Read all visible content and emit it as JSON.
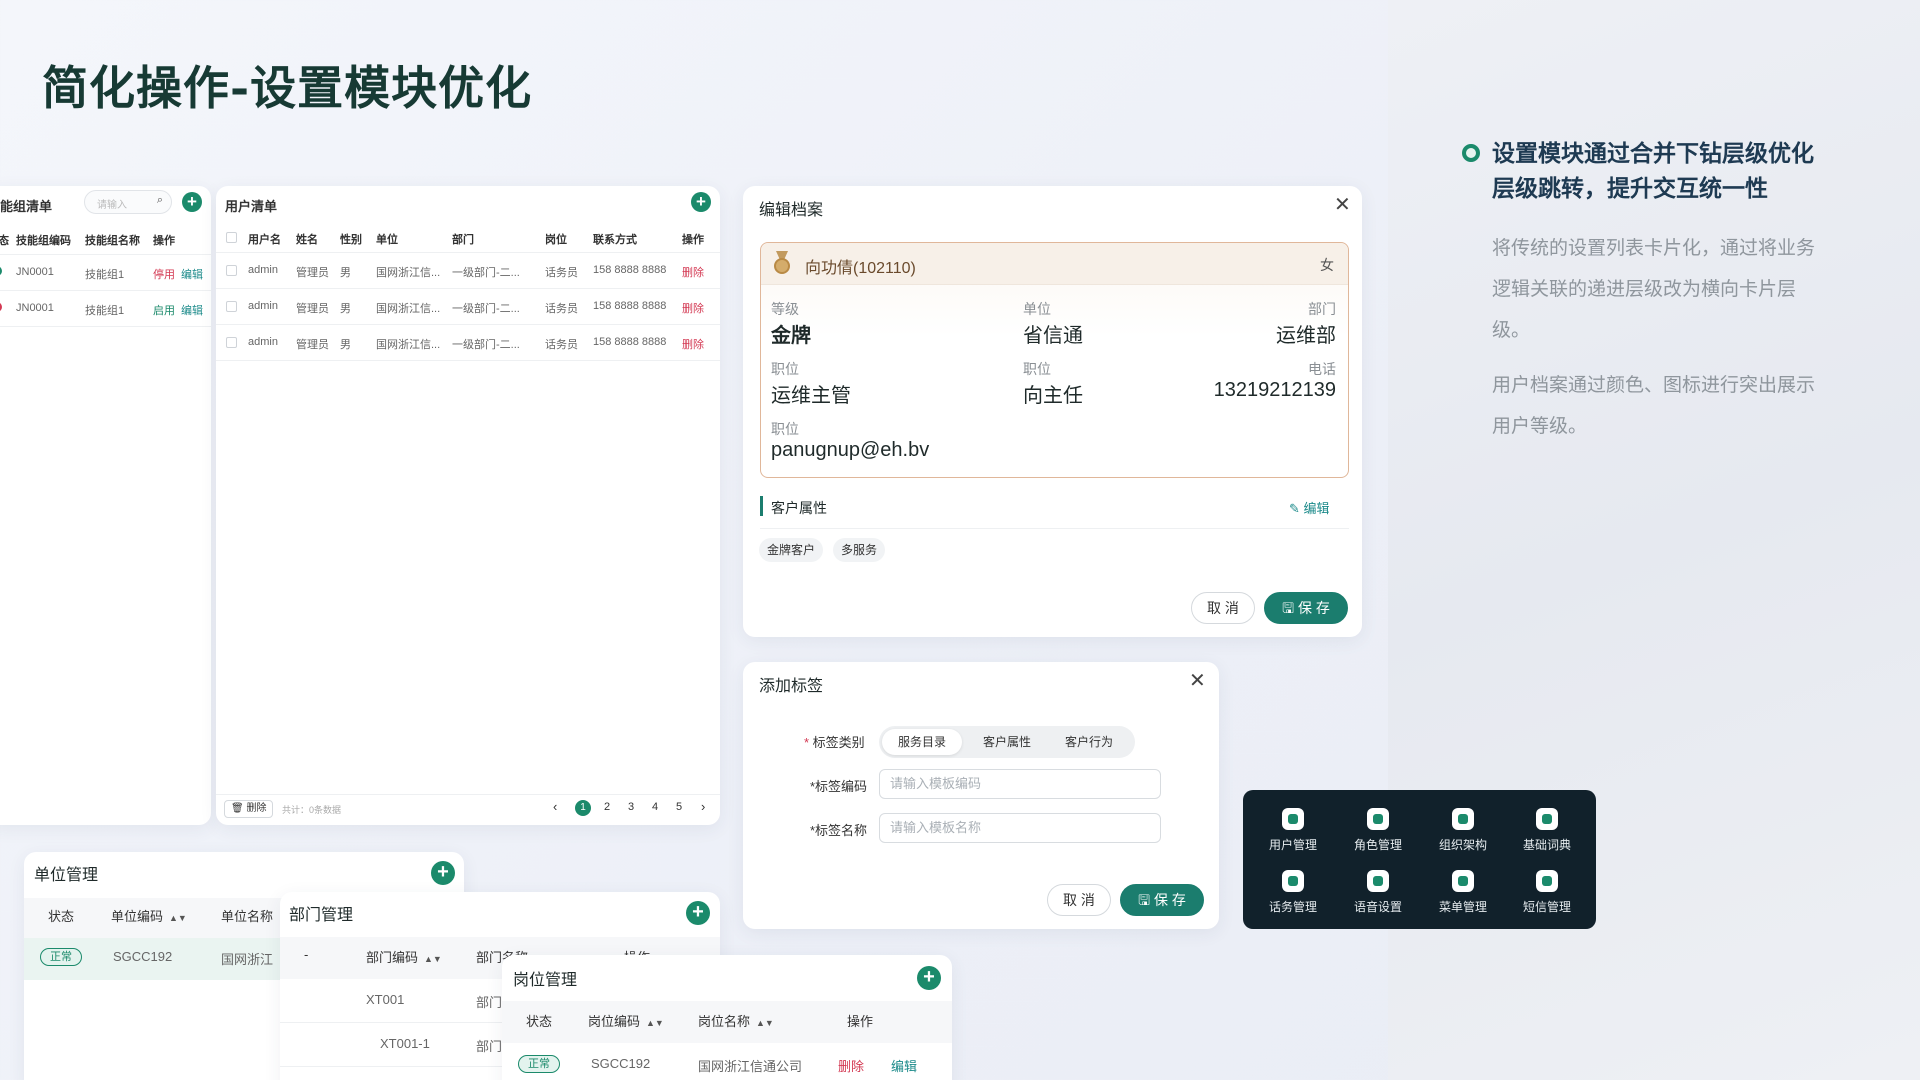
{
  "title": "简化操作-设置模块优化",
  "right": {
    "heading_line1": "设置模块通过合并下钻层级优化",
    "heading_line2": "层级跳转，提升交互统一性",
    "para1_line1": "将传统的设置列表卡片化，通过将业务",
    "para1_line2": "逻辑关联的递进层级改为横向卡片层",
    "para1_line3": "级。",
    "para2_line1": "用户档案通过颜色、图标进行突出展示",
    "para2_line2": "用户等级。"
  },
  "skill_list": {
    "title": "能组清单",
    "search_placeholder": "请输入",
    "cols": [
      "态",
      "技能组编码",
      "技能组名称",
      "操作"
    ],
    "rows": [
      {
        "code": "JN0001",
        "name": "技能组1",
        "toggle": "停用",
        "edit": "编辑"
      },
      {
        "code": "JN0001",
        "name": "技能组1",
        "toggle": "启用",
        "edit": "编辑"
      }
    ]
  },
  "user_list": {
    "title": "用户清单",
    "cols": [
      "用户名",
      "姓名",
      "性别",
      "单位",
      "部门",
      "岗位",
      "联系方式",
      "操作"
    ],
    "rows": [
      {
        "user": "admin",
        "name": "管理员",
        "gender": "男",
        "unit": "国网浙江信...",
        "dept": "一级部门-二...",
        "post": "话务员",
        "phone": "158 8888 8888",
        "op": "删除"
      },
      {
        "user": "admin",
        "name": "管理员",
        "gender": "男",
        "unit": "国网浙江信...",
        "dept": "一级部门-二...",
        "post": "话务员",
        "phone": "158 8888 8888",
        "op": "删除"
      },
      {
        "user": "admin",
        "name": "管理员",
        "gender": "男",
        "unit": "国网浙江信...",
        "dept": "一级部门-二...",
        "post": "话务员",
        "phone": "158 8888 8888",
        "op": "删除"
      }
    ],
    "delete_label": "删除",
    "total_label": "共计：0条数据",
    "pages": [
      "1",
      "2",
      "3",
      "4",
      "5"
    ],
    "current_page": "1"
  },
  "edit_profile": {
    "title": "编辑档案",
    "name": "向功倩(102110)",
    "gender": "女",
    "fields": [
      {
        "label": "等级",
        "value": "金牌"
      },
      {
        "label": "单位",
        "value": "省信通"
      },
      {
        "label": "部门",
        "value": "运维部"
      },
      {
        "label": "职位",
        "value": "运维主管"
      },
      {
        "label": "职位",
        "value": "向主任"
      },
      {
        "label": "电话",
        "value": "13219212139"
      },
      {
        "label": "职位",
        "value": "panugnup@eh.bv"
      }
    ],
    "section_title": "客户属性",
    "edit_label": "编辑",
    "tags": [
      "金牌客户",
      "多服务"
    ],
    "cancel": "取 消",
    "save": "保 存"
  },
  "add_tag": {
    "title": "添加标签",
    "category_label": "标签类别",
    "segments": [
      "服务目录",
      "客户属性",
      "客户行为"
    ],
    "active_segment": "服务目录",
    "code_label": "*标签编码",
    "code_placeholder": "请输入模板编码",
    "name_label": "*标签名称",
    "name_placeholder": "请输入模板名称",
    "cancel": "取 消",
    "save": "保 存"
  },
  "menu": {
    "items": [
      {
        "label": "用户管理",
        "icon": "user-shield-icon"
      },
      {
        "label": "角色管理",
        "icon": "role-icon"
      },
      {
        "label": "组织架构",
        "icon": "org-link-icon"
      },
      {
        "label": "基础词典",
        "icon": "dictionary-icon"
      },
      {
        "label": "话务管理",
        "icon": "phone-icon"
      },
      {
        "label": "语音设置",
        "icon": "voice-icon"
      },
      {
        "label": "菜单管理",
        "icon": "menu-icon"
      },
      {
        "label": "短信管理",
        "icon": "sms-icon"
      }
    ]
  },
  "unit_mgmt": {
    "title": "单位管理",
    "cols": [
      "状态",
      "单位编码",
      "单位名称"
    ],
    "row": {
      "status": "正常",
      "code": "SGCC192",
      "name": "国网浙江"
    }
  },
  "dept_mgmt": {
    "title": "部门管理",
    "cols": [
      "-",
      "部门编码",
      "部门名称",
      "操作"
    ],
    "rows": [
      {
        "code": "XT001",
        "name": "部门"
      },
      {
        "code": "XT001-1",
        "name": "部门"
      }
    ]
  },
  "post_mgmt": {
    "title": "岗位管理",
    "cols": [
      "状态",
      "岗位编码",
      "岗位名称",
      "操作"
    ],
    "row": {
      "status": "正常",
      "code": "SGCC192",
      "name": "国网浙江信通公司",
      "delete": "删除",
      "edit": "编辑"
    }
  },
  "colors": {
    "accent": "#1b8a6b",
    "danger": "#d33852",
    "dark": "#11212b"
  }
}
